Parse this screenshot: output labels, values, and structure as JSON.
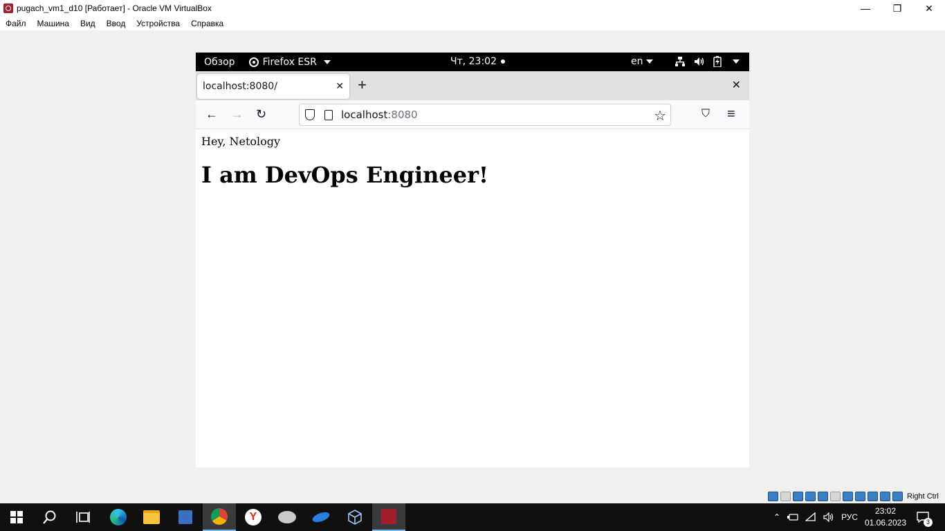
{
  "vbox": {
    "title": "pugach_vm1_d10 [Работает] - Oracle VM VirtualBox",
    "menu": [
      "Файл",
      "Машина",
      "Вид",
      "Ввод",
      "Устройства",
      "Справка"
    ],
    "minimize_glyph": "—",
    "restore_glyph": "❐",
    "close_glyph": "✕",
    "host_key": "Right Ctrl"
  },
  "gnome": {
    "activities": "Обзор",
    "app_name": "Firefox ESR",
    "clock": "Чт, 23:02",
    "lang": "en"
  },
  "firefox": {
    "tab_title": "localhost:8080/",
    "tab_close": "✕",
    "new_tab": "+",
    "window_close": "✕",
    "back": "←",
    "forward": "→",
    "reload": "↻",
    "url_host": "localhost",
    "url_port": ":8080",
    "star": "☆",
    "pocket": "⛉",
    "menu": "≡"
  },
  "page": {
    "greeting": "Hey, Netology",
    "heading": "I am DevOps Engineer!"
  },
  "taskbar": {
    "search_glyph": "⚲",
    "lang": "РУС",
    "time": "23:02",
    "date": "01.06.2023",
    "notifications": "3",
    "tray_chevron": "⌃",
    "wifi": "◠",
    "volume": "🔈"
  },
  "colors": {
    "vbox_accent": "#a31d2d",
    "taskbar_bg": "#101010",
    "active_underline": "#76b9ed"
  }
}
